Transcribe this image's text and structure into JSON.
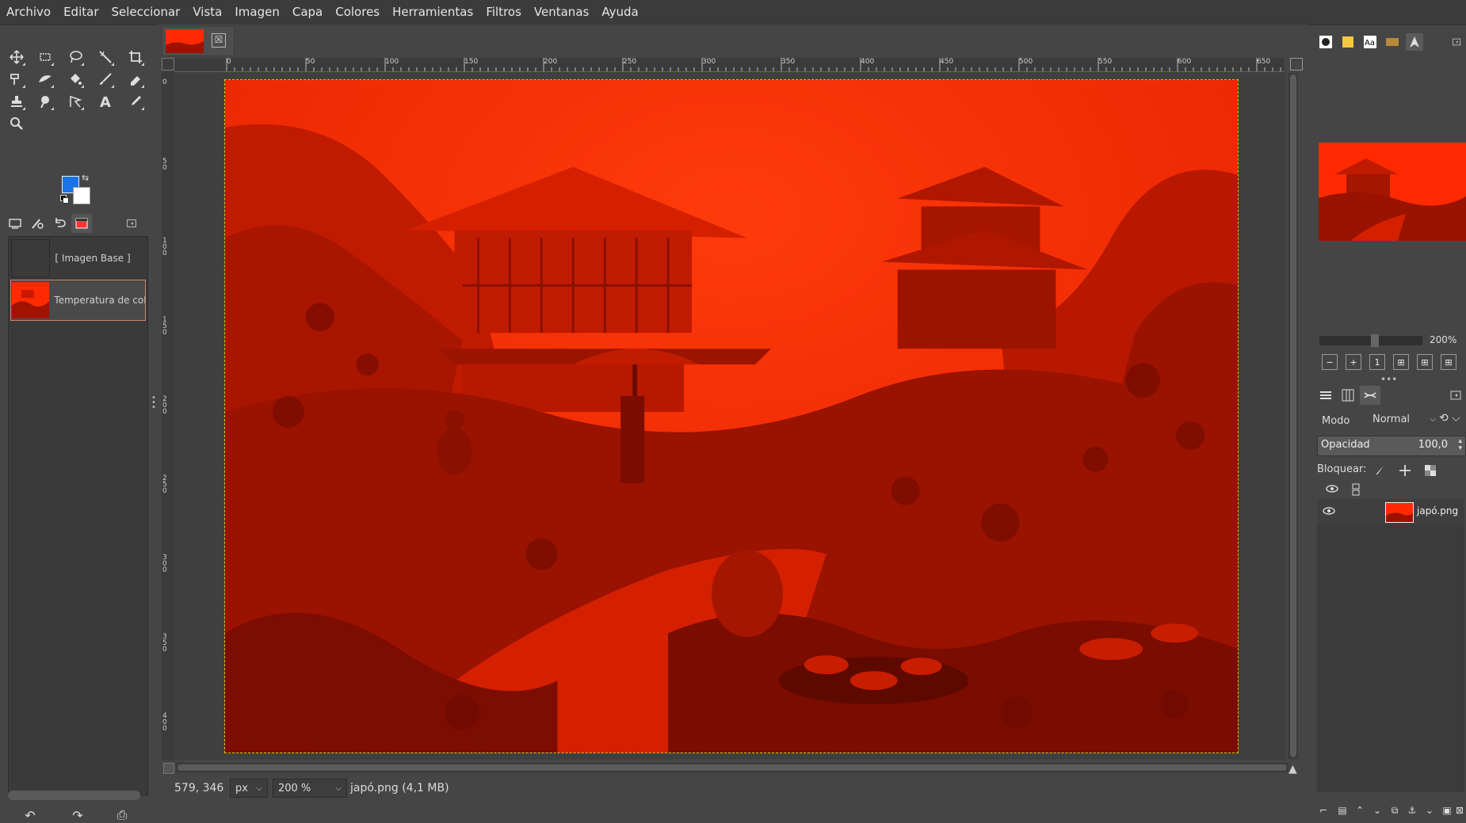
{
  "menu": [
    "Archivo",
    "Editar",
    "Seleccionar",
    "Vista",
    "Imagen",
    "Capa",
    "Colores",
    "Herramientas",
    "Filtros",
    "Ventanas",
    "Ayuda"
  ],
  "colors": {
    "foreground": "#1a73e8",
    "background": "#ffffff",
    "image_tint": "#ff2a00",
    "accent_border": "#c9866a",
    "selection": "#e6c000"
  },
  "tools": [
    "move-tool",
    "rect-select-tool",
    "free-select-tool",
    "fuzzy-select-tool",
    "crop-tool",
    "warp-tool",
    "smudge-tool",
    "bucket-fill-tool",
    "paintbrush-tool",
    "eraser-tool",
    "clone-tool",
    "dodge-tool",
    "path-tool",
    "text-tool",
    "color-picker-tool",
    "zoom-tool"
  ],
  "left_dock": {
    "tabs": [
      "tool-options",
      "device-status",
      "undo-history",
      "images"
    ],
    "history": [
      {
        "label": "[ Imagen Base ]"
      },
      {
        "label": "Temperatura de color"
      }
    ]
  },
  "image": {
    "tab_close": "☒",
    "ruler_top": [
      "0",
      "50",
      "100",
      "150",
      "200",
      "250",
      "300",
      "350",
      "400",
      "450",
      "500",
      "550",
      "600",
      "650"
    ],
    "ruler_left": [
      "0",
      "50",
      "100",
      "150",
      "200",
      "250",
      "300",
      "350",
      "400"
    ]
  },
  "status": {
    "coords": "579, 346",
    "unit": "px",
    "zoom": "200 %",
    "file": "japó.png (4,1 MB)"
  },
  "navigator": {
    "zoom_label": "200%"
  },
  "layers": {
    "mode_label": "Modo",
    "mode_value": "Normal",
    "opacity_label": "Opacidad",
    "opacity_value": "100,0",
    "lock_label": "Bloquear:",
    "items": [
      {
        "name": "japó.png",
        "visible": true
      }
    ]
  }
}
